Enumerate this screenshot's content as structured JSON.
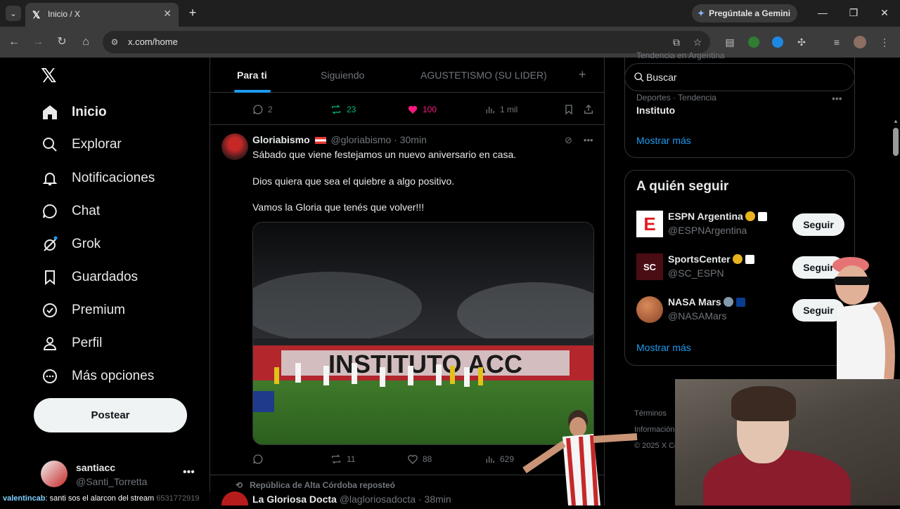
{
  "browser": {
    "tab_title": "Inicio / X",
    "gemini_label": "Pregúntale a Gemini",
    "url": "x.com/home"
  },
  "nav": {
    "items": [
      {
        "label": "Inicio",
        "icon": "home-icon"
      },
      {
        "label": "Explorar",
        "icon": "search-icon"
      },
      {
        "label": "Notificaciones",
        "icon": "bell-icon"
      },
      {
        "label": "Chat",
        "icon": "chat-icon"
      },
      {
        "label": "Grok",
        "icon": "grok-icon"
      },
      {
        "label": "Guardados",
        "icon": "bookmark-icon"
      },
      {
        "label": "Premium",
        "icon": "verified-badge-icon"
      },
      {
        "label": "Perfil",
        "icon": "person-icon"
      },
      {
        "label": "Más opciones",
        "icon": "more-circle-icon"
      }
    ],
    "post_label": "Postear",
    "account": {
      "name": "santiacc",
      "handle": "@Santi_Torretta"
    }
  },
  "feed": {
    "tabs": [
      "Para ti",
      "Siguiendo",
      "AGUSTETISMO (SU LIDER)"
    ],
    "prev_post_actions": {
      "replies": "2",
      "reposts": "23",
      "likes": "100",
      "views": "1 mil"
    },
    "post": {
      "name": "Gloriabismo",
      "handle": "@gloriabismo",
      "time": "· 30min",
      "lines": [
        "Sábado que viene festejamos un nuevo aniversario en casa.",
        "Dios quiera que sea el quiebre a algo positivo.",
        "Vamos la Gloria que tenés que volver!!!"
      ],
      "media_banner": "INSTITUTO ACC",
      "actions": {
        "replies": "",
        "reposts": "11",
        "likes": "88",
        "views": "629"
      }
    },
    "next_post": {
      "repost_note": "República de Alta Córdoba reposteó",
      "name": "La Gloriosa Docta",
      "handle": "@lagloriosadocta",
      "time": "· 38min"
    }
  },
  "sidebar": {
    "search_placeholder": "Buscar",
    "trend_meta_top": "Tendencia en Argentina",
    "trend_meta": "Deportes · Tendencia",
    "trend_name": "Instituto",
    "show_more": "Mostrar más",
    "who_to_follow_title": "A quién seguir",
    "follow": [
      {
        "name": "ESPN Argentina",
        "handle": "@ESPNArgentina",
        "button": "Seguir",
        "avatar_text": "E",
        "avatar_bg": "#ffffff",
        "avatar_fg": "#e21b22"
      },
      {
        "name": "SportsCenter",
        "handle": "@SC_ESPN",
        "button": "Seguir",
        "avatar_text": "SC",
        "avatar_bg": "#4a0d14",
        "avatar_fg": "#ffffff"
      },
      {
        "name": "NASA Mars",
        "handle": "@NASAMars",
        "button": "Seguir",
        "avatar_text": "",
        "avatar_bg": "#b4663a",
        "avatar_fg": "#ffffff"
      }
    ],
    "footer_terms": "Términos",
    "footer_info": "Información",
    "footer_copy": "© 2025 X Co"
  },
  "stream_chat": {
    "user": "valentincab",
    "message": ": santi sos el alarcon del stream",
    "tail": "6531772919"
  },
  "colors": {
    "accent": "#1d9bf0",
    "repost": "#00ba7c",
    "like": "#f91880"
  }
}
